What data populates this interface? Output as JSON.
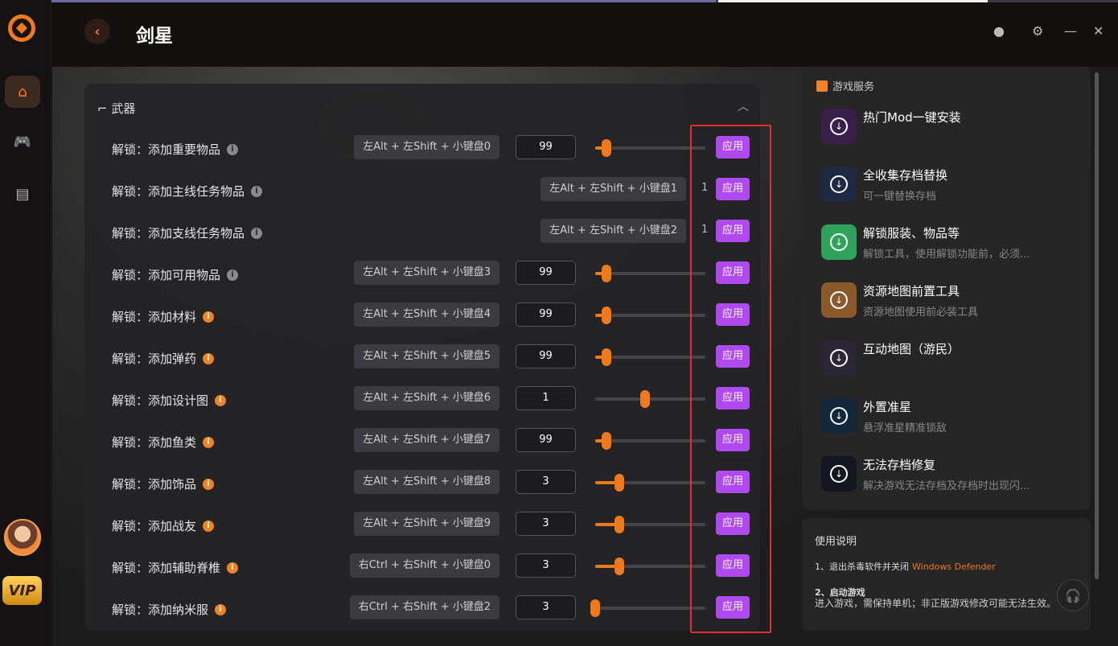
{
  "app": {
    "title": "剑星"
  },
  "section": {
    "title": "武器"
  },
  "rows": [
    {
      "label": "解锁：添加重要物品",
      "info": "grey",
      "hotkey": "左Alt + 左Shift + 小键盘0",
      "control": "slider",
      "value": "99",
      "level": 0.1
    },
    {
      "label": "解锁：添加主线任务物品",
      "info": "grey",
      "hotkey": "左Alt + 左Shift + 小键盘1",
      "control": "text",
      "value": "1"
    },
    {
      "label": "解锁：添加支线任务物品",
      "info": "grey",
      "hotkey": "左Alt + 左Shift + 小键盘2",
      "control": "text",
      "value": "1"
    },
    {
      "label": "解锁：添加可用物品",
      "info": "grey",
      "hotkey": "左Alt + 左Shift + 小键盘3",
      "control": "slider",
      "value": "99",
      "level": 0.1
    },
    {
      "label": "解锁：添加材料",
      "info": "orange",
      "hotkey": "左Alt + 左Shift + 小键盘4",
      "control": "slider",
      "value": "99",
      "level": 0.1
    },
    {
      "label": "解锁：添加弹药",
      "info": "orange",
      "hotkey": "左Alt + 左Shift + 小键盘5",
      "control": "slider",
      "value": "99",
      "level": 0.1
    },
    {
      "label": "解锁：添加设计图",
      "info": "orange",
      "hotkey": "左Alt + 左Shift + 小键盘6",
      "control": "slider",
      "value": "1",
      "level": 0.45,
      "nofill": true
    },
    {
      "label": "解锁：添加鱼类",
      "info": "orange",
      "hotkey": "左Alt + 左Shift + 小键盘7",
      "control": "slider",
      "value": "99",
      "level": 0.1
    },
    {
      "label": "解锁：添加饰品",
      "info": "orange",
      "hotkey": "左Alt + 左Shift + 小键盘8",
      "control": "slider",
      "value": "3",
      "level": 0.22
    },
    {
      "label": "解锁：添加战友",
      "info": "orange",
      "hotkey": "左Alt + 左Shift + 小键盘9",
      "control": "slider",
      "value": "3",
      "level": 0.22
    },
    {
      "label": "解锁：添加辅助脊椎",
      "info": "orange",
      "hotkey": "右Ctrl + 右Shift + 小键盘0",
      "control": "slider",
      "value": "3",
      "level": 0.22
    },
    {
      "label": "解锁：添加纳米服",
      "info": "orange",
      "hotkey": "右Ctrl + 右Shift + 小键盘2",
      "control": "slider",
      "value": "3",
      "level": 0.0
    }
  ],
  "apply_label": "应用",
  "services": {
    "title": "游戏服务",
    "items": [
      {
        "name": "热门Mod一键安装",
        "desc": "",
        "color": "#3a1f4a"
      },
      {
        "name": "全收集存档替换",
        "desc": "可一键替换存档",
        "color": "#1e2a44"
      },
      {
        "name": "解锁服装、物品等",
        "desc": "解锁工具，使用解锁功能前，必须...",
        "color": "#2fa35a"
      },
      {
        "name": "资源地图前置工具",
        "desc": "资源地图使用前必装工具",
        "color": "#8a5a2a"
      },
      {
        "name": "互动地图（游民）",
        "desc": "",
        "color": "#2a2636"
      },
      {
        "name": "外置准星",
        "desc": "悬浮准星精准锁敌",
        "color": "#12283a"
      },
      {
        "name": "无法存档修复",
        "desc": "解决游戏无法存档及存档时出现闪...",
        "color": "#161620"
      }
    ]
  },
  "help": {
    "title": "使用说明",
    "step1": "1、退出杀毒软件并关闭",
    "step1_highlight": "Windows Defender",
    "step2": "2、启动游戏",
    "step2_desc": "进入游戏，需保持单机；非正版游戏修改可能无法生效。"
  },
  "sidebar": {
    "vip_label": "VIP"
  }
}
